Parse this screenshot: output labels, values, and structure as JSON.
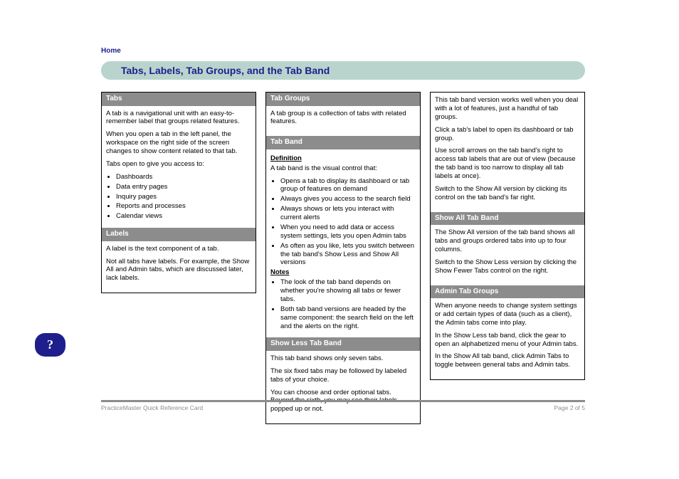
{
  "breadcrumb": "Home",
  "title": "Tabs, Labels, Tab Groups, and the Tab Band",
  "col1": {
    "sec1": {
      "head": "Tabs",
      "body1": "A tab is a navigational unit with an easy-to-remember label that groups related features.",
      "body2": "When you open a tab in the left panel, the workspace on the right side of the screen changes to show content related to that tab.",
      "body3": "Tabs open to give you access to:",
      "items": [
        "Dashboards",
        "Data entry pages",
        "Inquiry pages",
        "Reports and processes",
        "Calendar views"
      ]
    },
    "sec2": {
      "head": "Labels",
      "body1": "A label is the text component of a tab.",
      "body2": "Not all tabs have labels. For example, the Show All and Admin tabs, which are discussed later, lack labels."
    }
  },
  "col2": {
    "sec1": {
      "head": "Tab Groups",
      "body": "A tab group is a collection of tabs with related features."
    },
    "sec2": {
      "head": "Tab Band",
      "sub1": "Definition",
      "body1": "A tab band is the visual control that:",
      "items1": [
        "Opens a tab to display its dashboard or tab group of features on demand",
        "Always gives you access to the search field",
        "Always shows or lets you interact with current alerts",
        "When you need to add data or access system settings, lets you open Admin tabs",
        "As often as you like, lets you switch between the tab band's Show Less and Show All versions"
      ],
      "sub2": "Notes",
      "items2": [
        "The look of the tab band depends on whether you're showing all tabs or fewer tabs.",
        "Both tab band versions are headed by the same component: the search field on the left and the alerts on the right."
      ]
    },
    "sec3": {
      "head": "Show Less Tab Band",
      "body1": "This tab band shows only seven tabs.",
      "body2": "The six fixed tabs may be followed by labeled tabs of your choice.",
      "body3": "You can choose and order optional tabs. Beyond the sixth, you may see their labels popped up or not."
    }
  },
  "col3": {
    "sec1": {
      "head": "",
      "body1": "This tab band version works well when you deal with a lot of features, just a handful of tab groups.",
      "body2": "Click a tab's label to open its dashboard or tab group.",
      "body3": "Use scroll arrows on the tab band's right to access tab labels that are out of view (because the tab band is too narrow to display all tab labels at once).",
      "body4": "Switch to the Show All version by clicking its control on the tab band's far right."
    },
    "sec2": {
      "head": "Show All Tab Band",
      "body1": "The Show All version of the tab band shows all tabs and groups ordered tabs into up to four columns.",
      "body2": "Switch to the Show Less version by clicking the Show Fewer Tabs control on the right."
    },
    "sec3": {
      "head": "Admin Tab Groups",
      "body1": "When anyone needs to change system settings or add certain types of data (such as a client), the Admin tabs come into play.",
      "body2": "In the Show Less tab band, click the gear to open an alphabetized menu of your Admin tabs.",
      "body3": "In the Show All tab band, click Admin Tabs to toggle between general tabs and Admin tabs."
    }
  },
  "help_badge": "?",
  "footer": {
    "left": "PracticeMaster Quick Reference Card",
    "right": "Page 2 of 5"
  }
}
